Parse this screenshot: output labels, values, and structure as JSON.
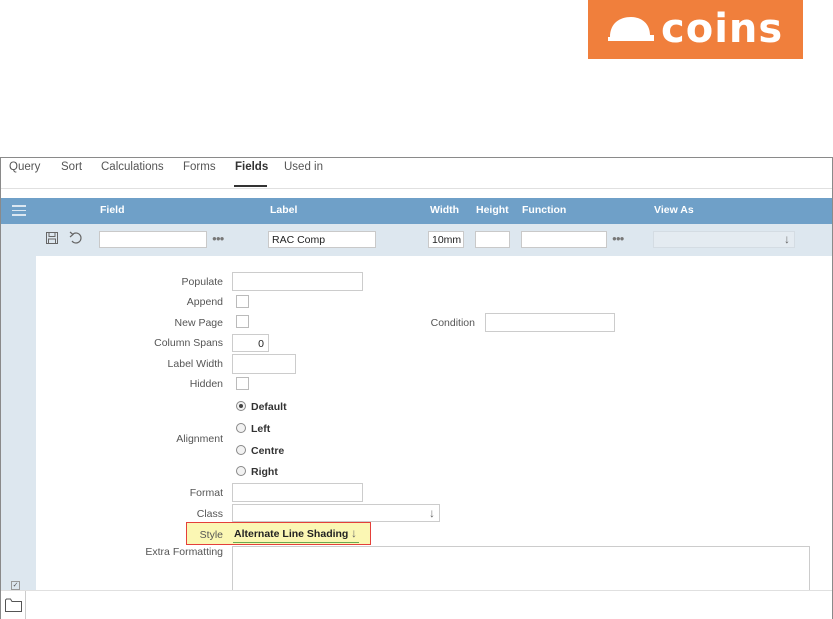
{
  "brand": {
    "logo_text": "coins",
    "color": "#f07f3c"
  },
  "tabs": [
    {
      "label": "Query"
    },
    {
      "label": "Sort"
    },
    {
      "label": "Calculations"
    },
    {
      "label": "Forms"
    },
    {
      "label": "Fields"
    },
    {
      "label": "Used in"
    }
  ],
  "active_tab": "Fields",
  "grid_header": {
    "field": "Field",
    "label": "Label",
    "width": "Width",
    "height": "Height",
    "function": "Function",
    "view_as": "View As"
  },
  "edit_row": {
    "field_value": "",
    "label_value": "RAC Comp",
    "width_value": "10mm",
    "height_value": "",
    "function_value": "",
    "view_as_value": ""
  },
  "form": {
    "populate_label": "Populate",
    "populate_value": "",
    "append_label": "Append",
    "new_page_label": "New Page",
    "condition_label": "Condition",
    "condition_value": "",
    "column_spans_label": "Column Spans",
    "column_spans_value": "0",
    "label_width_label": "Label Width",
    "label_width_value": "",
    "hidden_label": "Hidden",
    "alignment_label": "Alignment",
    "alignment_options": [
      "Default",
      "Left",
      "Centre",
      "Right"
    ],
    "alignment_selected": "Default",
    "format_label": "Format",
    "format_value": "",
    "class_label": "Class",
    "class_value": "",
    "style_label": "Style",
    "style_value": "Alternate Line Shading",
    "extra_formatting_label": "Extra Formatting",
    "extra_formatting_value": ""
  },
  "colors": {
    "header_bar": "#6fa0c8",
    "edit_row": "#dde7ef",
    "highlight_border": "#e4403a",
    "highlight_fill": "#fbf7b4"
  }
}
